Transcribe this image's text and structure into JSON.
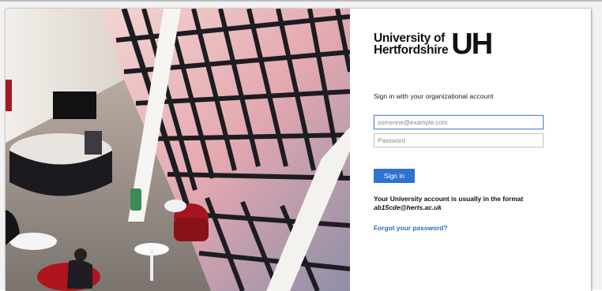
{
  "brand": {
    "name_line1": "University of",
    "name_line2": "Hertfordshire",
    "mark": "UH"
  },
  "signin": {
    "prompt": "Sign in with your organizational account",
    "email_placeholder": "someone@example.com",
    "password_placeholder": "Password",
    "button_label": "Sign in",
    "info_text": "Your University account is usually in the format",
    "info_format": "ab15cde@herts.ac.uk",
    "forgot_link": "Forgot your password?"
  },
  "colors": {
    "accent": "#2f73d1",
    "link": "#2f6db5",
    "text": "#111111"
  }
}
